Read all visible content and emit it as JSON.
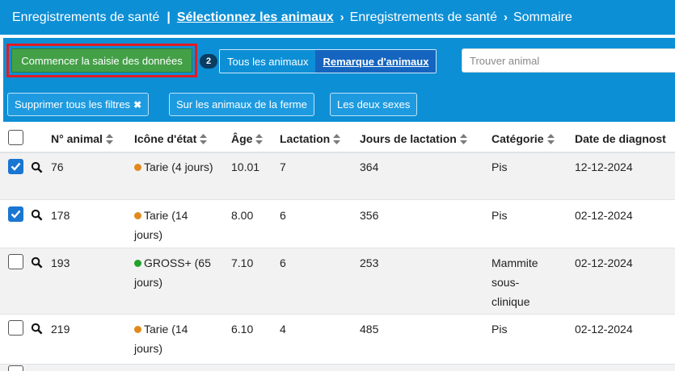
{
  "breadcrumb": {
    "root": "Enregistrements de santé",
    "separator": "|",
    "current": "Sélectionnez les animaux",
    "step2": "Enregistrements de santé",
    "step3": "Sommaire"
  },
  "toolbar": {
    "start_label": "Commencer la saisie des données",
    "selected_count": "2",
    "view_options": [
      "Tous les animaux",
      "Remarque d'animaux"
    ],
    "active_view": "Remarque d'animaux",
    "search_placeholder": "Trouver animal",
    "filters": {
      "clear_all": "Supprimer tous les filtres",
      "farm_animals": "Sur les animaux de la ferme",
      "both_sexes": "Les deux sexes"
    }
  },
  "table": {
    "columns": [
      "N° animal",
      "Icône d'état",
      "Âge",
      "Lactation",
      "Jours de lactation",
      "Catégorie",
      "Date de diagnost"
    ],
    "rows": [
      {
        "checked": true,
        "number": "76",
        "status_color": "#e08a1e",
        "status_line1": "Tarie (4 jours)",
        "status_line2": "",
        "age": "10.01",
        "lactation": "7",
        "days": "364",
        "cat1": "Pis",
        "cat2": "",
        "cat3": "",
        "date": "12-12-2024"
      },
      {
        "checked": true,
        "number": "178",
        "status_color": "#e08a1e",
        "status_line1": "Tarie (14",
        "status_line2": "jours)",
        "age": "8.00",
        "lactation": "6",
        "days": "356",
        "cat1": "Pis",
        "cat2": "",
        "cat3": "",
        "date": "02-12-2024"
      },
      {
        "checked": false,
        "number": "193",
        "status_color": "#22a32a",
        "status_line1": "GROSS+ (65",
        "status_line2": "jours)",
        "age": "7.10",
        "lactation": "6",
        "days": "253",
        "cat1": "Mammite",
        "cat2": "sous-",
        "cat3": "clinique",
        "date": "02-12-2024"
      },
      {
        "checked": false,
        "number": "219",
        "status_color": "#e08a1e",
        "status_line1": "Tarie (14",
        "status_line2": "jours)",
        "age": "6.10",
        "lactation": "4",
        "days": "485",
        "cat1": "Pis",
        "cat2": "",
        "cat3": "",
        "date": "02-12-2024"
      }
    ]
  }
}
